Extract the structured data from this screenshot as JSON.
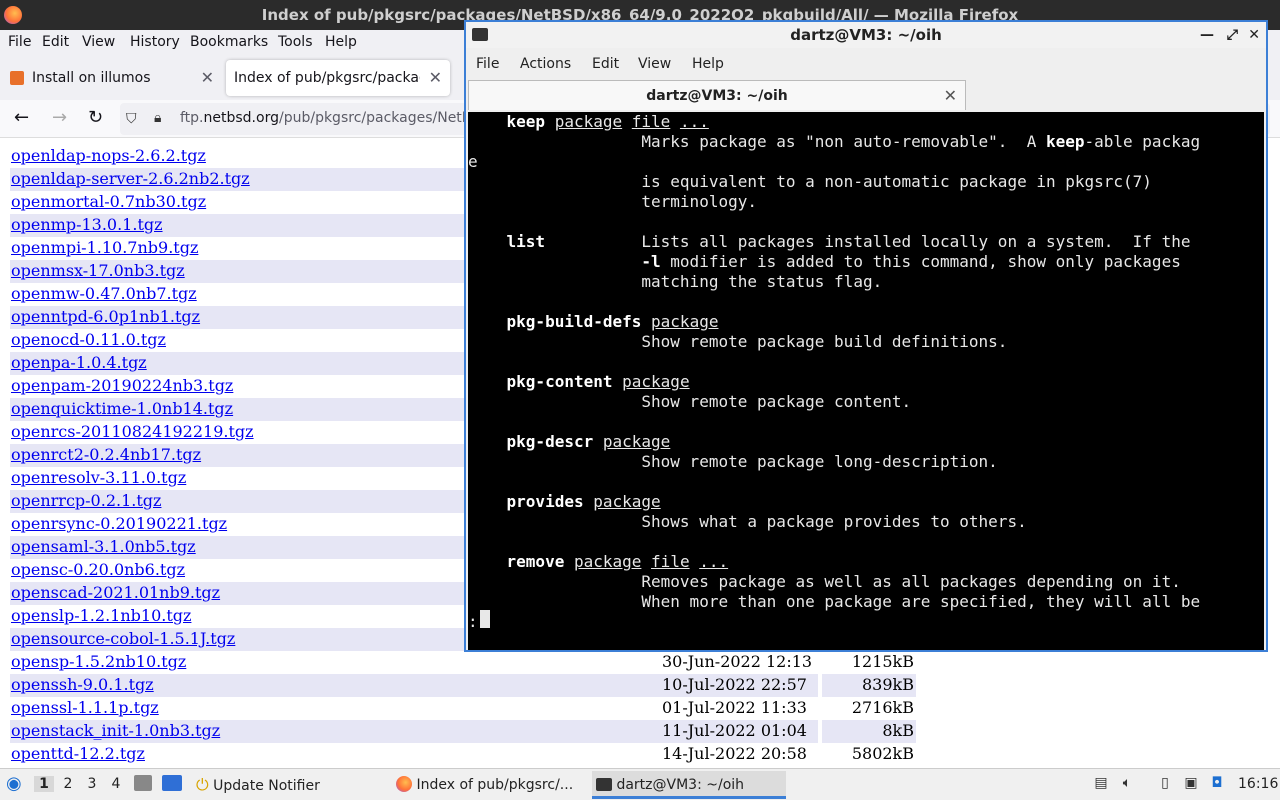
{
  "firefox": {
    "window_title": "Index of pub/pkgsrc/packages/NetBSD/x86_64/9.0_2022Q2_pkgbuild/All/ — Mozilla Firefox",
    "menu": [
      "File",
      "Edit",
      "View",
      "History",
      "Bookmarks",
      "Tools",
      "Help"
    ],
    "tabs": [
      {
        "label": "Install on illumos"
      },
      {
        "label": "Index of pub/pkgsrc/packag"
      }
    ],
    "url_prefix": "ftp.",
    "url_domain": "netbsd.org",
    "url_path": "/pub/pkgsrc/packages/NetBSD/x86_64/9.0_2022Q2_pkgbuild/All/",
    "files": [
      {
        "name": "openldap-nops-2.6.2.tgz",
        "date": "",
        "size": ""
      },
      {
        "name": "openldap-server-2.6.2nb2.tgz",
        "date": "",
        "size": ""
      },
      {
        "name": "openmortal-0.7nb30.tgz",
        "date": "",
        "size": ""
      },
      {
        "name": "openmp-13.0.1.tgz",
        "date": "",
        "size": ""
      },
      {
        "name": "openmpi-1.10.7nb9.tgz",
        "date": "",
        "size": ""
      },
      {
        "name": "openmsx-17.0nb3.tgz",
        "date": "",
        "size": ""
      },
      {
        "name": "openmw-0.47.0nb7.tgz",
        "date": "",
        "size": ""
      },
      {
        "name": "openntpd-6.0p1nb1.tgz",
        "date": "",
        "size": ""
      },
      {
        "name": "openocd-0.11.0.tgz",
        "date": "",
        "size": ""
      },
      {
        "name": "openpa-1.0.4.tgz",
        "date": "",
        "size": ""
      },
      {
        "name": "openpam-20190224nb3.tgz",
        "date": "",
        "size": ""
      },
      {
        "name": "openquicktime-1.0nb14.tgz",
        "date": "",
        "size": ""
      },
      {
        "name": "openrcs-20110824192219.tgz",
        "date": "",
        "size": ""
      },
      {
        "name": "openrct2-0.2.4nb17.tgz",
        "date": "",
        "size": ""
      },
      {
        "name": "openresolv-3.11.0.tgz",
        "date": "",
        "size": ""
      },
      {
        "name": "openrrcp-0.2.1.tgz",
        "date": "",
        "size": ""
      },
      {
        "name": "openrsync-0.20190221.tgz",
        "date": "",
        "size": ""
      },
      {
        "name": "opensaml-3.1.0nb5.tgz",
        "date": "",
        "size": ""
      },
      {
        "name": "opensc-0.20.0nb6.tgz",
        "date": "",
        "size": ""
      },
      {
        "name": "openscad-2021.01nb9.tgz",
        "date": "",
        "size": ""
      },
      {
        "name": "openslp-1.2.1nb10.tgz",
        "date": "",
        "size": ""
      },
      {
        "name": "opensource-cobol-1.5.1J.tgz",
        "date": "",
        "size": ""
      },
      {
        "name": "opensp-1.5.2nb10.tgz",
        "date": "30-Jun-2022 12:13",
        "size": "1215kB"
      },
      {
        "name": "openssh-9.0.1.tgz",
        "date": "10-Jul-2022 22:57",
        "size": "839kB"
      },
      {
        "name": "openssl-1.1.1p.tgz",
        "date": "01-Jul-2022 11:33",
        "size": "2716kB"
      },
      {
        "name": "openstack_init-1.0nb3.tgz",
        "date": "11-Jul-2022 01:04",
        "size": "8kB"
      },
      {
        "name": "openttd-12.2.tgz",
        "date": "14-Jul-2022 20:58",
        "size": "5802kB"
      }
    ]
  },
  "terminal": {
    "title": "dartz@VM3: ~/oih",
    "menu": [
      "File",
      "Actions",
      "Edit",
      "View",
      "Help"
    ],
    "tab_label": "dartz@VM3: ~/oih",
    "lines": [
      [
        {
          "t": "    "
        },
        {
          "t": "keep",
          "s": "b"
        },
        {
          "t": " "
        },
        {
          "t": "package",
          "s": "u"
        },
        {
          "t": " "
        },
        {
          "t": "file",
          "s": "u"
        },
        {
          "t": " "
        },
        {
          "t": "...",
          "s": "u"
        }
      ],
      [
        {
          "t": "                  Marks package as \"non auto-removable\".  A "
        },
        {
          "t": "keep",
          "s": "b"
        },
        {
          "t": "-able packag"
        }
      ],
      [
        {
          "t": "e"
        }
      ],
      [
        {
          "t": "                  is equivalent to a non-automatic package in pkgsrc(7)"
        }
      ],
      [
        {
          "t": "                  terminology."
        }
      ],
      [
        {
          "t": ""
        }
      ],
      [
        {
          "t": "    "
        },
        {
          "t": "list",
          "s": "b"
        },
        {
          "t": "          Lists all packages installed locally on a system.  If the"
        }
      ],
      [
        {
          "t": "                  "
        },
        {
          "t": "-l",
          "s": "b"
        },
        {
          "t": " modifier is added to this command, show only packages"
        }
      ],
      [
        {
          "t": "                  matching the status flag."
        }
      ],
      [
        {
          "t": ""
        }
      ],
      [
        {
          "t": "    "
        },
        {
          "t": "pkg-build-defs",
          "s": "b"
        },
        {
          "t": " "
        },
        {
          "t": "package",
          "s": "u"
        }
      ],
      [
        {
          "t": "                  Show remote package build definitions."
        }
      ],
      [
        {
          "t": ""
        }
      ],
      [
        {
          "t": "    "
        },
        {
          "t": "pkg-content",
          "s": "b"
        },
        {
          "t": " "
        },
        {
          "t": "package",
          "s": "u"
        }
      ],
      [
        {
          "t": "                  Show remote package content."
        }
      ],
      [
        {
          "t": ""
        }
      ],
      [
        {
          "t": "    "
        },
        {
          "t": "pkg-descr",
          "s": "b"
        },
        {
          "t": " "
        },
        {
          "t": "package",
          "s": "u"
        }
      ],
      [
        {
          "t": "                  Show remote package long-description."
        }
      ],
      [
        {
          "t": ""
        }
      ],
      [
        {
          "t": "    "
        },
        {
          "t": "provides",
          "s": "b"
        },
        {
          "t": " "
        },
        {
          "t": "package",
          "s": "u"
        }
      ],
      [
        {
          "t": "                  Shows what a package provides to others."
        }
      ],
      [
        {
          "t": ""
        }
      ],
      [
        {
          "t": "    "
        },
        {
          "t": "remove",
          "s": "b"
        },
        {
          "t": " "
        },
        {
          "t": "package",
          "s": "u"
        },
        {
          "t": " "
        },
        {
          "t": "file",
          "s": "u"
        },
        {
          "t": " "
        },
        {
          "t": "...",
          "s": "u"
        }
      ],
      [
        {
          "t": "                  Removes package as well as all packages depending on it."
        }
      ],
      [
        {
          "t": "                  When more than one package are specified, they will all be"
        }
      ],
      [
        {
          "t": ":"
        }
      ]
    ]
  },
  "taskbar": {
    "workspaces": [
      "1",
      "2",
      "3",
      "4"
    ],
    "tasks": [
      {
        "label": "Update Notifier",
        "icon": "update-notifier-icon"
      },
      {
        "label": "Index of pub/pkgsrc/...",
        "icon": "firefox-icon"
      },
      {
        "label": "dartz@VM3: ~/oih",
        "icon": "terminal-icon"
      }
    ],
    "clock": "16:16"
  }
}
